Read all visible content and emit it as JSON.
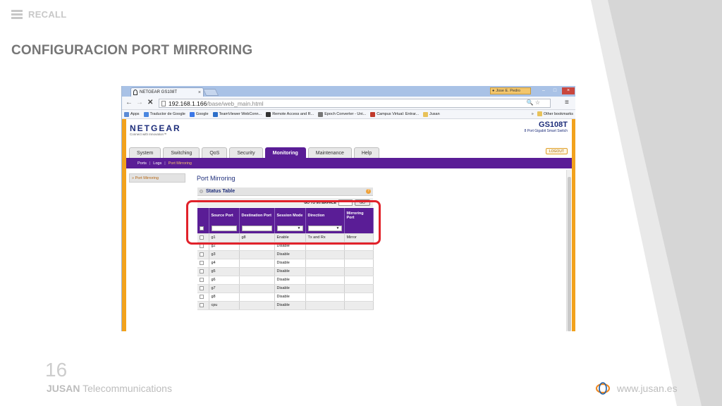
{
  "slide": {
    "recall_label": "RECALL",
    "title": "CONFIGURACION PORT MIRRORING",
    "page_number": "16",
    "footer_brand_bold": "JUSAN",
    "footer_brand_rest": " Telecommunications",
    "footer_url": "www.jusan.es"
  },
  "browser": {
    "tab_title": "NETGEAR GS108T",
    "tab_close": "×",
    "user_badge": "Jose E. Pedro",
    "win_min": "–",
    "win_max": "□",
    "win_close": "×",
    "url_host": "192.168.1.166",
    "url_path": "/base/web_main.html",
    "bookmarks": [
      {
        "label": "Apps",
        "color": "#5a8ad6"
      },
      {
        "label": "Traductor de Google",
        "color": "#4a87e0"
      },
      {
        "label": "Google",
        "color": "#3b78e7"
      },
      {
        "label": "TeamViewer WebConn...",
        "color": "#2d6fc9"
      },
      {
        "label": "Remote Access and R...",
        "color": "#333333"
      },
      {
        "label": "Epoch Converter - Uni...",
        "color": "#777777"
      },
      {
        "label": "Campus Virtual: Entrar...",
        "color": "#c0392b"
      },
      {
        "label": "Jusan",
        "color": "#e8c25a"
      }
    ],
    "bookmarks_more": "»",
    "other_bookmarks": "Other bookmarks"
  },
  "netgear": {
    "logo": "NETGEAR",
    "tagline": "Connect with Innovation™",
    "model": "GS108T",
    "model_sub": "8 Port Gigabit Smart Switch",
    "logout": "LOGOUT",
    "tabs": [
      {
        "label": "System",
        "active": false
      },
      {
        "label": "Switching",
        "active": false
      },
      {
        "label": "QoS",
        "active": false
      },
      {
        "label": "Security",
        "active": false
      },
      {
        "label": "Monitoring",
        "active": true
      },
      {
        "label": "Maintenance",
        "active": false
      },
      {
        "label": "Help",
        "active": false
      }
    ],
    "subnav": {
      "ports": "Ports",
      "logs": "Logs",
      "mirroring": "Port Mirroring",
      "sep": "|"
    },
    "left_menu": "» Port Mirroring",
    "page_title": "Port Mirroring",
    "status_table": "Status Table",
    "help_glyph": "?",
    "goto_label": "GO TO INTERFACE",
    "go_button": "GO",
    "columns": {
      "source": "Source Port",
      "destination": "Destination Port",
      "session": "Session Mode",
      "direction": "Direction",
      "mirroring": "Mirroring Port"
    },
    "select_arrow": "▼",
    "rows": [
      {
        "source": "g1",
        "destination": "g8",
        "session": "Enable",
        "direction": "Tx and Rx",
        "mirroring": "Mirror"
      },
      {
        "source": "g2",
        "destination": "",
        "session": "Disable",
        "direction": "",
        "mirroring": ""
      },
      {
        "source": "g3",
        "destination": "",
        "session": "Disable",
        "direction": "",
        "mirroring": ""
      },
      {
        "source": "g4",
        "destination": "",
        "session": "Disable",
        "direction": "",
        "mirroring": ""
      },
      {
        "source": "g5",
        "destination": "",
        "session": "Disable",
        "direction": "",
        "mirroring": ""
      },
      {
        "source": "g6",
        "destination": "",
        "session": "Disable",
        "direction": "",
        "mirroring": ""
      },
      {
        "source": "g7",
        "destination": "",
        "session": "Disable",
        "direction": "",
        "mirroring": ""
      },
      {
        "source": "g8",
        "destination": "",
        "session": "Disable",
        "direction": "",
        "mirroring": ""
      },
      {
        "source": "cpu",
        "destination": "",
        "session": "Disable",
        "direction": "",
        "mirroring": ""
      }
    ]
  },
  "colors": {
    "netgear_purple": "#5a1d96",
    "netgear_orange": "#f2a21d",
    "highlight_red": "#e1222b",
    "title_gray": "#767676"
  }
}
